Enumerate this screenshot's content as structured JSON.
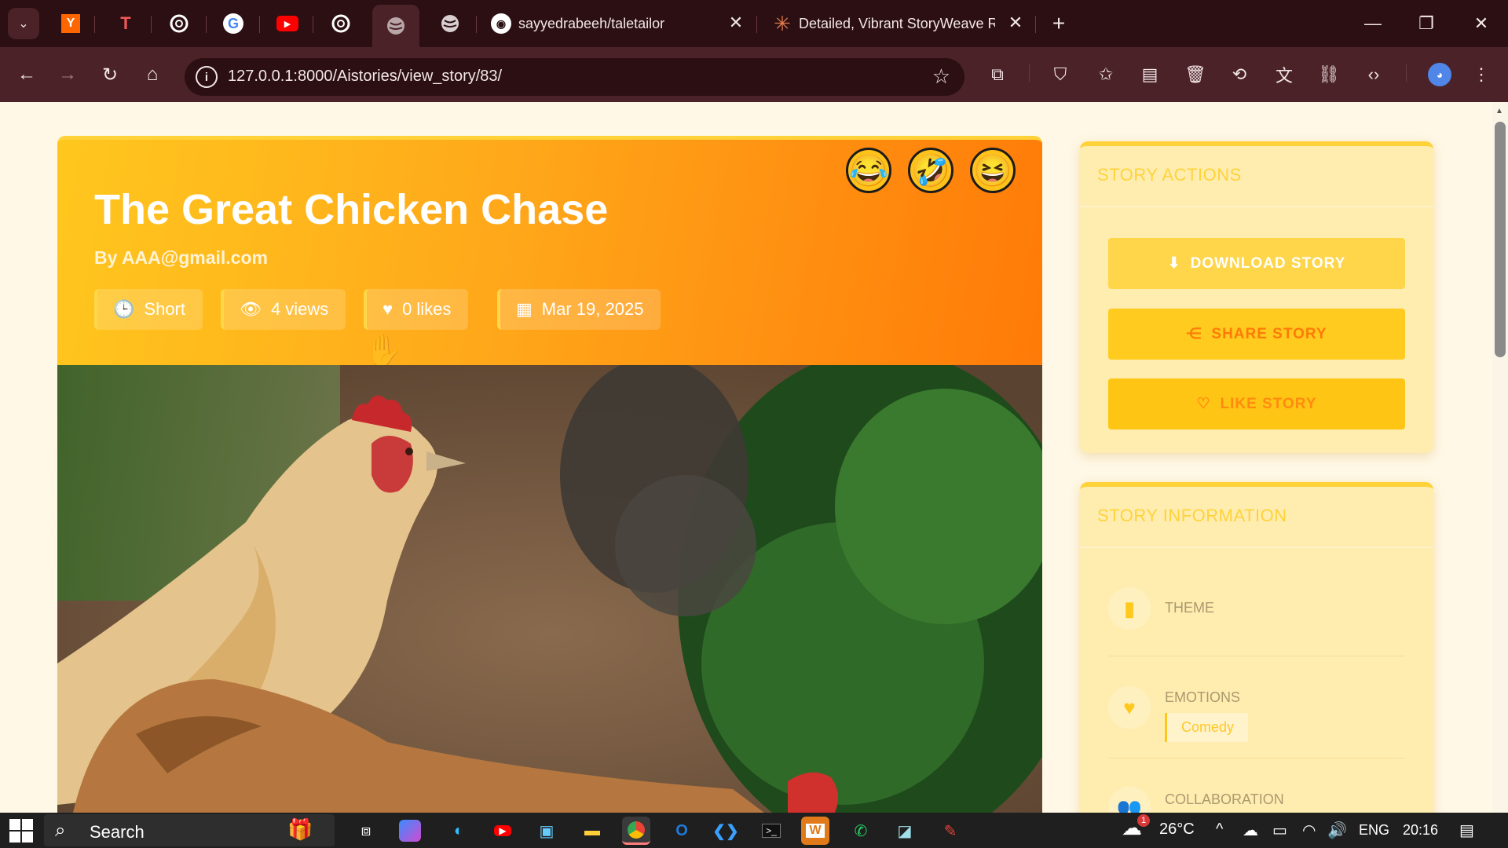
{
  "browser": {
    "tabs": [
      {
        "title": "sayyedrabeeh/taletailor",
        "close": "✕"
      },
      {
        "title": "Detailed, Vibrant StoryWeave R",
        "close": "✕"
      }
    ],
    "new_tab": "+",
    "address": "127.0.0.1:8000/Aistories/view_story/83/"
  },
  "story": {
    "title": "The Great Chicken Chase",
    "author": "By AAA@gmail.com",
    "meta": {
      "length": "Short",
      "views": "4 views",
      "likes": "0 likes",
      "date": "Mar 19, 2025"
    },
    "emojis": [
      "😂",
      "🤣",
      "😆"
    ]
  },
  "sidebar": {
    "actions": {
      "heading": "STORY ACTIONS",
      "download": "DOWNLOAD STORY",
      "share": "SHARE STORY",
      "like": "LIKE STORY"
    },
    "info": {
      "heading": "STORY INFORMATION",
      "theme_label": "THEME",
      "emotions_label": "EMOTIONS",
      "emotions_tag": "Comedy",
      "collaboration_label": "COLLABORATION"
    }
  },
  "taskbar": {
    "search": "Search",
    "weather": "26°C",
    "language": "ENG",
    "time": "20:16",
    "weather_badge": "1"
  },
  "colors": {
    "accent": "#ffc71e",
    "hero_end": "#ff7a08",
    "browser_dark": "#2b0f12",
    "browser_toolbar": "#4a2228"
  }
}
